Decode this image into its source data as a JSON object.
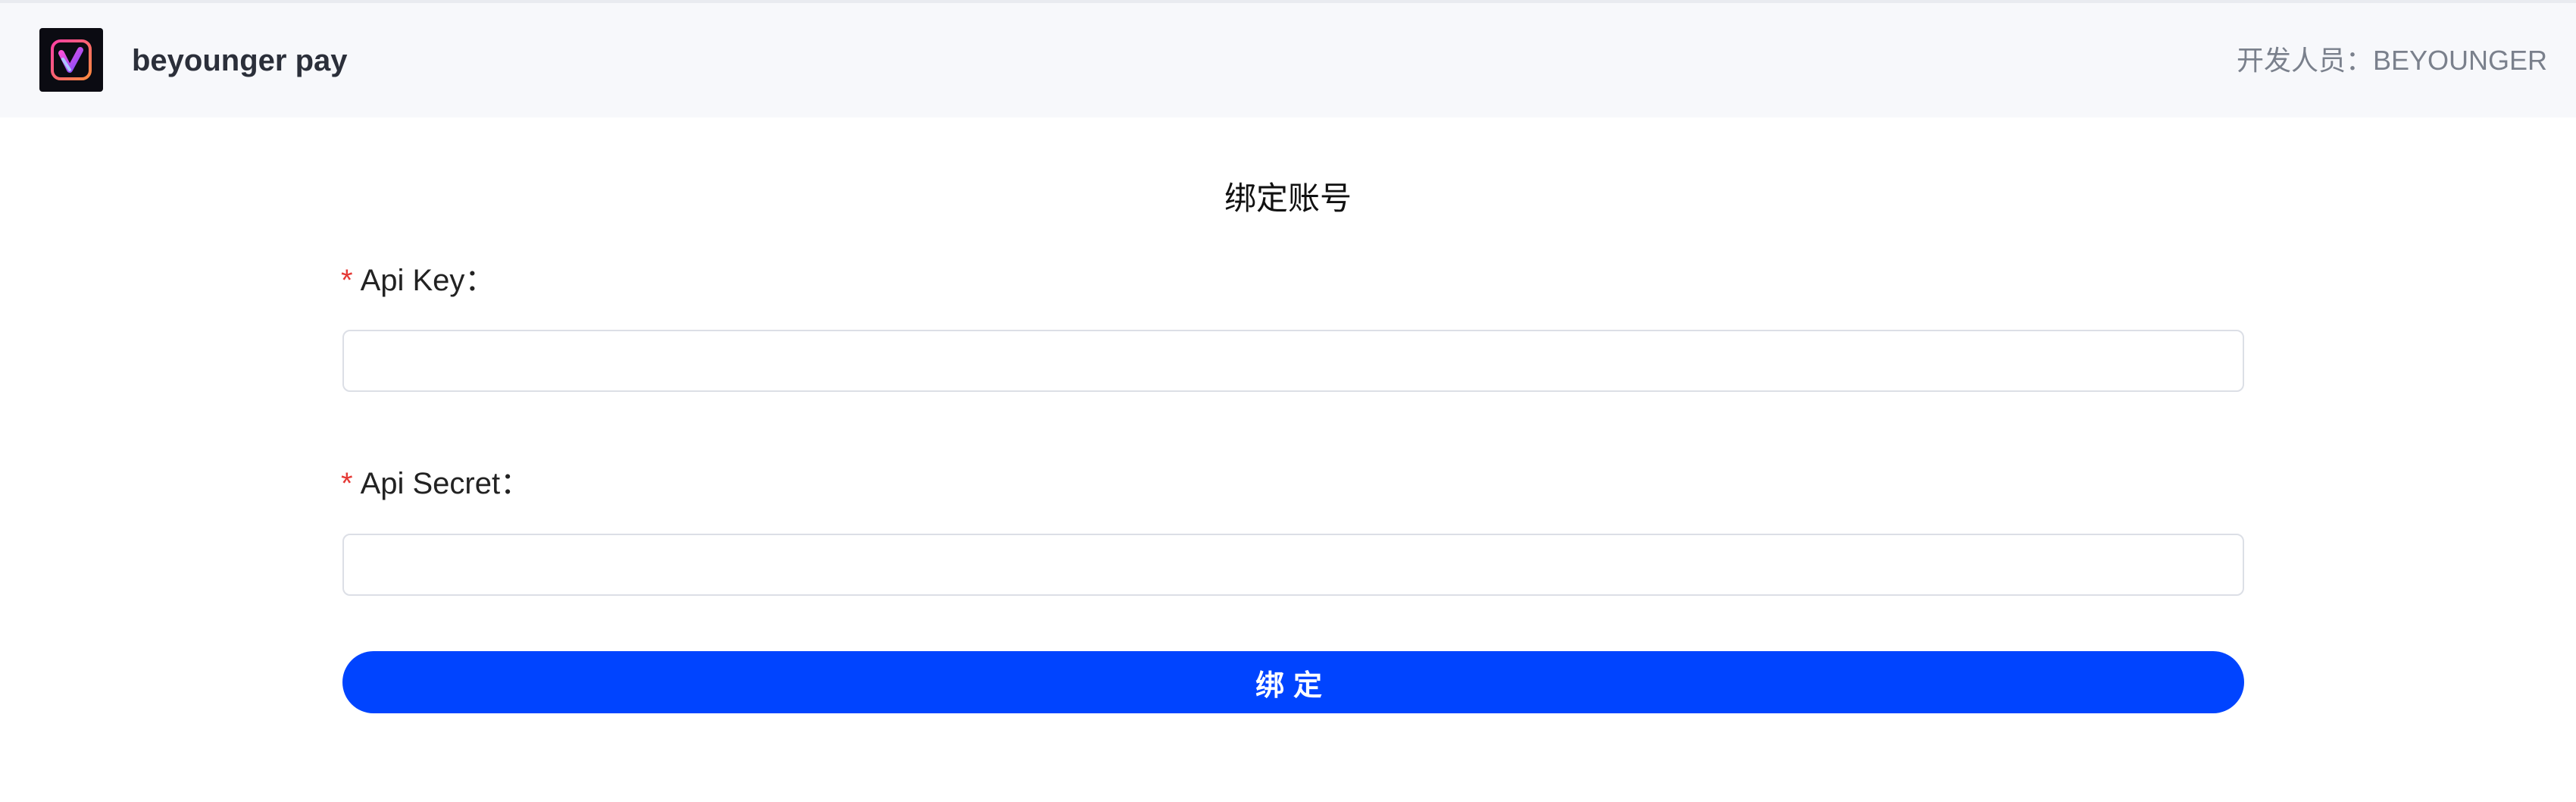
{
  "header": {
    "app_name": "beyounger pay",
    "developer_label": "开发人员：",
    "developer_name": "BEYOUNGER",
    "logo_icon": "beyounger-v-logo-icon"
  },
  "form": {
    "title": "绑定账号",
    "api_key": {
      "required_mark": "*",
      "label": "Api Key：",
      "value": "",
      "placeholder": ""
    },
    "api_secret": {
      "required_mark": "*",
      "label": "Api Secret：",
      "value": "",
      "placeholder": ""
    },
    "submit_label": "绑定"
  },
  "colors": {
    "primary": "#0044ff",
    "required": "#e53935",
    "header_bg": "#f7f8fb"
  }
}
